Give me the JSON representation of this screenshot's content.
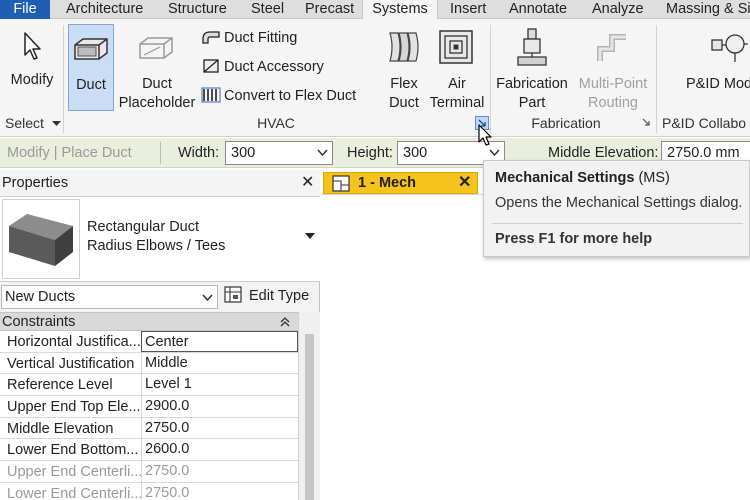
{
  "tabs": {
    "file": "File",
    "items": [
      "Architecture",
      "Structure",
      "Steel",
      "Precast",
      "Systems",
      "Insert",
      "Annotate",
      "Analyze",
      "Massing & Si"
    ],
    "active": "Systems"
  },
  "ribbon": {
    "select": {
      "modify": "Modify",
      "panel": "Select"
    },
    "hvac": {
      "duct": "Duct",
      "placeholder_line1": "Duct",
      "placeholder_line2": "Placeholder",
      "fitting": "Duct  Fitting",
      "accessory": "Duct  Accessory",
      "convert": "Convert to  Flex Duct",
      "flex_line1": "Flex",
      "flex_line2": "Duct",
      "air_line1": "Air",
      "air_line2": "Terminal",
      "panel": "HVAC"
    },
    "fabrication": {
      "part_line1": "Fabrication",
      "part_line2": "Part",
      "routing_line1": "Multi-Point",
      "routing_line2": "Routing",
      "panel": "Fabrication"
    },
    "pid": {
      "label": "P&ID Mod",
      "panel": "P&ID Collabo"
    }
  },
  "options_bar": {
    "context": "Modify | Place Duct",
    "width_label": "Width:",
    "width_value": "300",
    "height_label": "Height:",
    "height_value": "300",
    "elevation_label": "Middle Elevation:",
    "elevation_value": "2750.0 mm"
  },
  "properties": {
    "title": "Properties",
    "type_line1": "Rectangular Duct",
    "type_line2": "Radius Elbows / Tees",
    "instance_filter": "New Ducts",
    "edit_type": "Edit Type",
    "group": "Constraints",
    "rows": [
      {
        "name": "Horizontal Justifica...",
        "value": "Center"
      },
      {
        "name": "Vertical Justification",
        "value": "Middle"
      },
      {
        "name": "Reference Level",
        "value": "Level 1"
      },
      {
        "name": "Upper End Top Ele...",
        "value": "2900.0"
      },
      {
        "name": "Middle Elevation",
        "value": "2750.0"
      },
      {
        "name": "Lower End Bottom...",
        "value": "2600.0"
      },
      {
        "name": "Upper End Centerli...",
        "value": "2750.0"
      },
      {
        "name": "Lower End Centerli...",
        "value": "2750.0"
      }
    ]
  },
  "view_tab": {
    "label": "1 - Mech"
  },
  "tooltip": {
    "title": "Mechanical Settings",
    "shortcut": "(MS)",
    "description": "Opens the Mechanical Settings dialog.",
    "help": "Press F1 for more help"
  },
  "colors": {
    "file_tab": "#1e5fb3",
    "selected_button": "#c9def5",
    "options_bar": "#e9efdc",
    "view_tab": "#f6c21c"
  }
}
